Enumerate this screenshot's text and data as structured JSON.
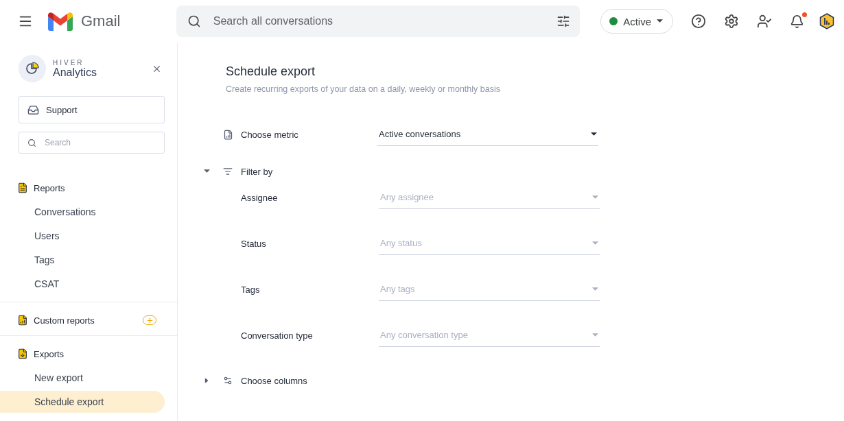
{
  "app_bar": {
    "product": "Gmail",
    "search": {
      "placeholder": "Search all conversations"
    },
    "status": {
      "label": "Active",
      "color": "#1e8e3e"
    },
    "notifications_unread": true
  },
  "sidebar": {
    "brand_kicker": "HIVER",
    "brand_name": "Analytics",
    "inbox": "Support",
    "search": {
      "placeholder": "Search"
    },
    "sections": [
      {
        "kind": "reports",
        "label": "Reports",
        "add": false,
        "items": [
          {
            "label": "Conversations",
            "selected": false
          },
          {
            "label": "Users",
            "selected": false
          },
          {
            "label": "Tags",
            "selected": false
          },
          {
            "label": "CSAT",
            "selected": false
          }
        ]
      },
      {
        "kind": "custom",
        "label": "Custom reports",
        "add": true
      },
      {
        "kind": "exports",
        "label": "Exports",
        "add": false,
        "items": [
          {
            "label": "New export",
            "selected": false
          },
          {
            "label": "Schedule export",
            "selected": true
          }
        ]
      }
    ]
  },
  "form": {
    "title": "Schedule export",
    "subtitle": "Create recurring exports of your data on a daily, weekly or monthly basis",
    "metric": {
      "label": "Choose metric",
      "value": "Active conversations"
    },
    "filter": {
      "label": "Filter by",
      "expanded": true,
      "fields": [
        {
          "label": "Assignee",
          "placeholder": "Any assignee"
        },
        {
          "label": "Status",
          "placeholder": "Any status"
        },
        {
          "label": "Tags",
          "placeholder": "Any tags"
        },
        {
          "label": "Conversation type",
          "placeholder": "Any conversation type"
        }
      ]
    },
    "columns": {
      "label": "Choose columns",
      "expanded": false
    }
  }
}
